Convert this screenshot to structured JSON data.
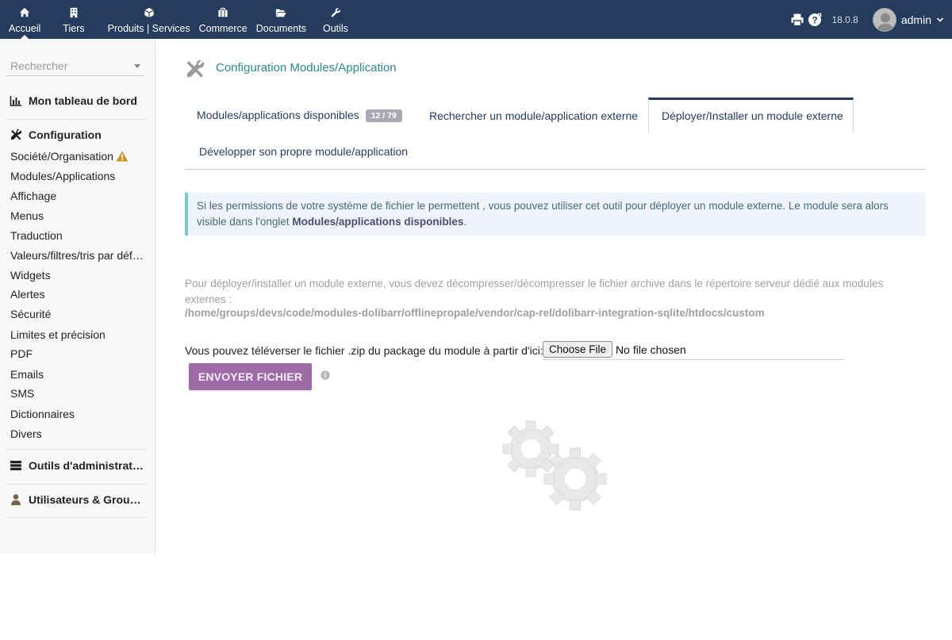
{
  "topbar": {
    "menu": [
      {
        "label": "Accueil",
        "icon": "home-icon"
      },
      {
        "label": "Tiers",
        "icon": "building-icon"
      },
      {
        "label": "Produits | Services",
        "icon": "cube-icon"
      },
      {
        "label": "Commerce",
        "icon": "briefcase-icon"
      },
      {
        "label": "Documents",
        "icon": "folder-open-icon"
      },
      {
        "label": "Outils",
        "icon": "wrench-icon"
      }
    ],
    "version": "18.0.8",
    "username": "admin"
  },
  "sidebar": {
    "search_placeholder": "Rechercher",
    "dashboard": "Mon tableau de bord",
    "configuration": "Configuration",
    "config_items": [
      "Société/Organisation",
      "Modules/Applications",
      "Affichage",
      "Menus",
      "Traduction",
      "Valeurs/filtres/tris par défaut",
      "Widgets",
      "Alertes",
      "Sécurité",
      "Limites et précision",
      "PDF",
      "Emails",
      "SMS",
      "Dictionnaires",
      "Divers"
    ],
    "admin_tools": "Outils d'administration",
    "users_groups": "Utilisateurs & Groupes"
  },
  "main": {
    "title": "Configuration Modules/Application",
    "tabs": {
      "available": "Modules/applications disponibles",
      "available_badge": "12 / 79",
      "search_external": "Rechercher un module/application externe",
      "deploy": "Déployer/Installer un module externe",
      "develop": "Développer son propre module/application"
    },
    "info_text": "Si les permissions de votre système de fichier le permettent , vous pouvez utiliser cet outil pour déployer un module externe. Le module sera alors visible dans l'onglet ",
    "info_bold": "Modules/applications disponibles",
    "info_end": ".",
    "deploy_text": "Pour déployer/installer un module externe, vous devez décompresser/décompresser le fichier archive dans le répertoire serveur dédié aux modules externes :",
    "deploy_path": "/home/groups/devs/code/modules-dolibarr/offlinepropale/vendor/cap-rel/dolibarr-integration-sqlite/htdocs/custom",
    "upload_label": "Vous pouvez téléverser le fichier .zip du package du module à partir d'ici:",
    "choose_file": "Choose File",
    "no_file": "No file chosen",
    "send_button": "ENVOYER FICHIER"
  },
  "colors": {
    "topbar": "#263c5c",
    "title": "#2c8b8b",
    "send_button": "#a069a8",
    "info_border": "#7cc8c8"
  }
}
